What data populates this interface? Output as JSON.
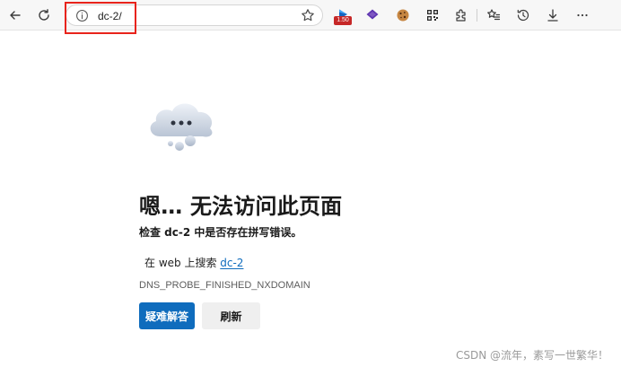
{
  "colors": {
    "accent": "#0f6cbd",
    "highlight_box": "#e8231b",
    "toolbar_bg": "#f7f7f7"
  },
  "toolbar": {
    "back_icon": "arrow-left-icon",
    "refresh_icon": "refresh-icon",
    "address": {
      "text": "dc-2/",
      "info_icon": "info-icon",
      "favorite_icon": "star-icon"
    },
    "extensions": [
      {
        "icon": "play-extension-icon",
        "badge": "1.50"
      },
      {
        "icon": "purple-layers-extension-icon"
      },
      {
        "icon": "cookie-extension-icon"
      },
      {
        "icon": "qr-code-extension-icon"
      },
      {
        "icon": "puzzle-icon"
      }
    ],
    "right_icons": [
      "favorites-icon",
      "history-icon",
      "download-icon",
      "more-icon"
    ]
  },
  "error_page": {
    "icon": "cloud-error-icon",
    "title": "嗯… 无法访问此页面",
    "subtitle": "检查 dc-2 中是否存在拼写错误。",
    "search_prefix": "在 web 上搜索 ",
    "search_link": "dc-2",
    "error_code": "DNS_PROBE_FINISHED_NXDOMAIN",
    "primary_button": "疑难解答",
    "secondary_button": "刷新"
  },
  "watermark": "CSDN @流年，素写一世繁华！"
}
